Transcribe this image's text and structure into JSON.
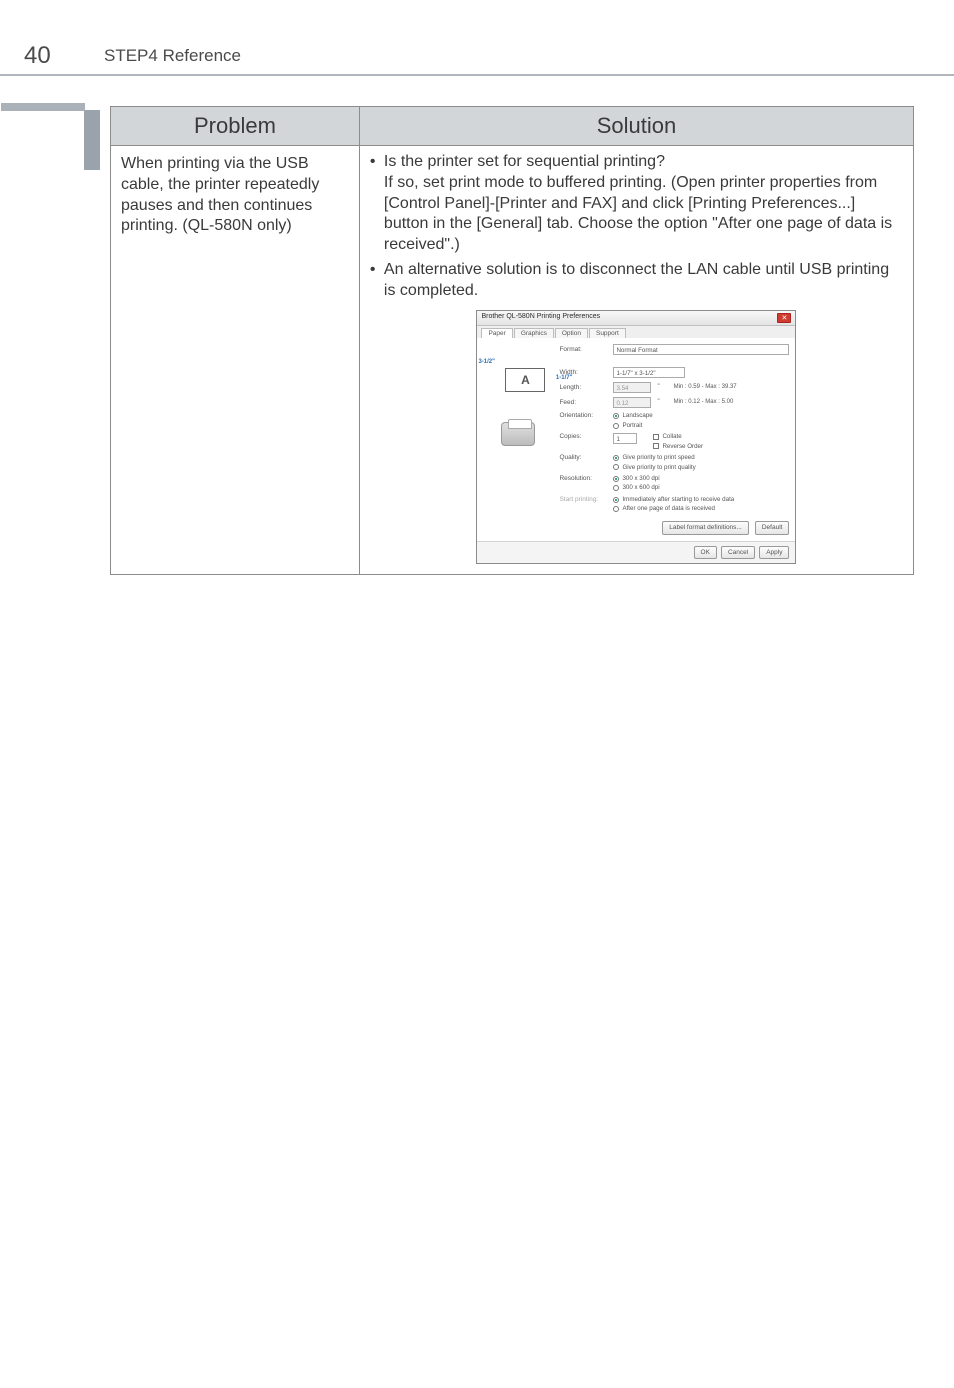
{
  "header": {
    "page_number": "40",
    "title": "STEP4 Reference"
  },
  "table": {
    "headers": [
      "Problem",
      "Solution"
    ],
    "row": {
      "problem": "When printing via the USB cable, the printer repeatedly pauses and then continues printing.++(QL-580N only)",
      "solution": {
        "bullet1": {
          "title": "Is the printer set for sequential printing?",
          "text": "If so, set print mode to buffered printing. (Open printer properties from [Control Panel]-[Printer and FAX] and click [Printing Preferences...] button in the [General] tab. Choose the option \"After one page of data is received\".)"
        },
        "bullet2": "An alternative solution is to disconnect the LAN cable until USB printing is completed."
      }
    }
  },
  "dialog": {
    "title": "Brother QL-580N Printing Preferences",
    "close_glyph": "✕",
    "tabs": [
      "Paper",
      "Graphics",
      "Option",
      "Support"
    ],
    "preview": {
      "letter": "A",
      "dim_w": "3-1/2\"",
      "dim_l": "1-1/7\""
    },
    "fields": {
      "format": {
        "label": "Format:",
        "value": "Normal Format"
      },
      "width": {
        "label": "Width:",
        "value": "1-1/7\" x 3-1/2\""
      },
      "length": {
        "label": "Length:",
        "value": "3.54",
        "unit": "\"",
        "range": "Min : 0.59 - Max : 39.37"
      },
      "feed": {
        "label": "Feed:",
        "value": "0.12",
        "unit": "\"",
        "range": "Min : 0.12 - Max : 5.00"
      },
      "orientation": {
        "label": "Orientation:",
        "options": [
          "Landscape",
          "Portrait"
        ]
      },
      "copies": {
        "label": "Copies:",
        "value": "1",
        "options": [
          "Collate",
          "Reverse Order"
        ]
      },
      "quality": {
        "label": "Quality:",
        "options": [
          "Give priority to print speed",
          "Give priority to print quality"
        ]
      },
      "resolution": {
        "label": "Resolution:",
        "options": [
          "300 x 300 dpi",
          "300 x 600 dpi"
        ]
      },
      "start_printing": {
        "label": "Start printing:",
        "options": [
          "Immediately after starting to receive data",
          "After one page of data is received"
        ]
      }
    },
    "buttons": {
      "label_format": "Label format definitions...",
      "default": "Default",
      "ok": "OK",
      "cancel": "Cancel",
      "apply": "Apply"
    }
  }
}
